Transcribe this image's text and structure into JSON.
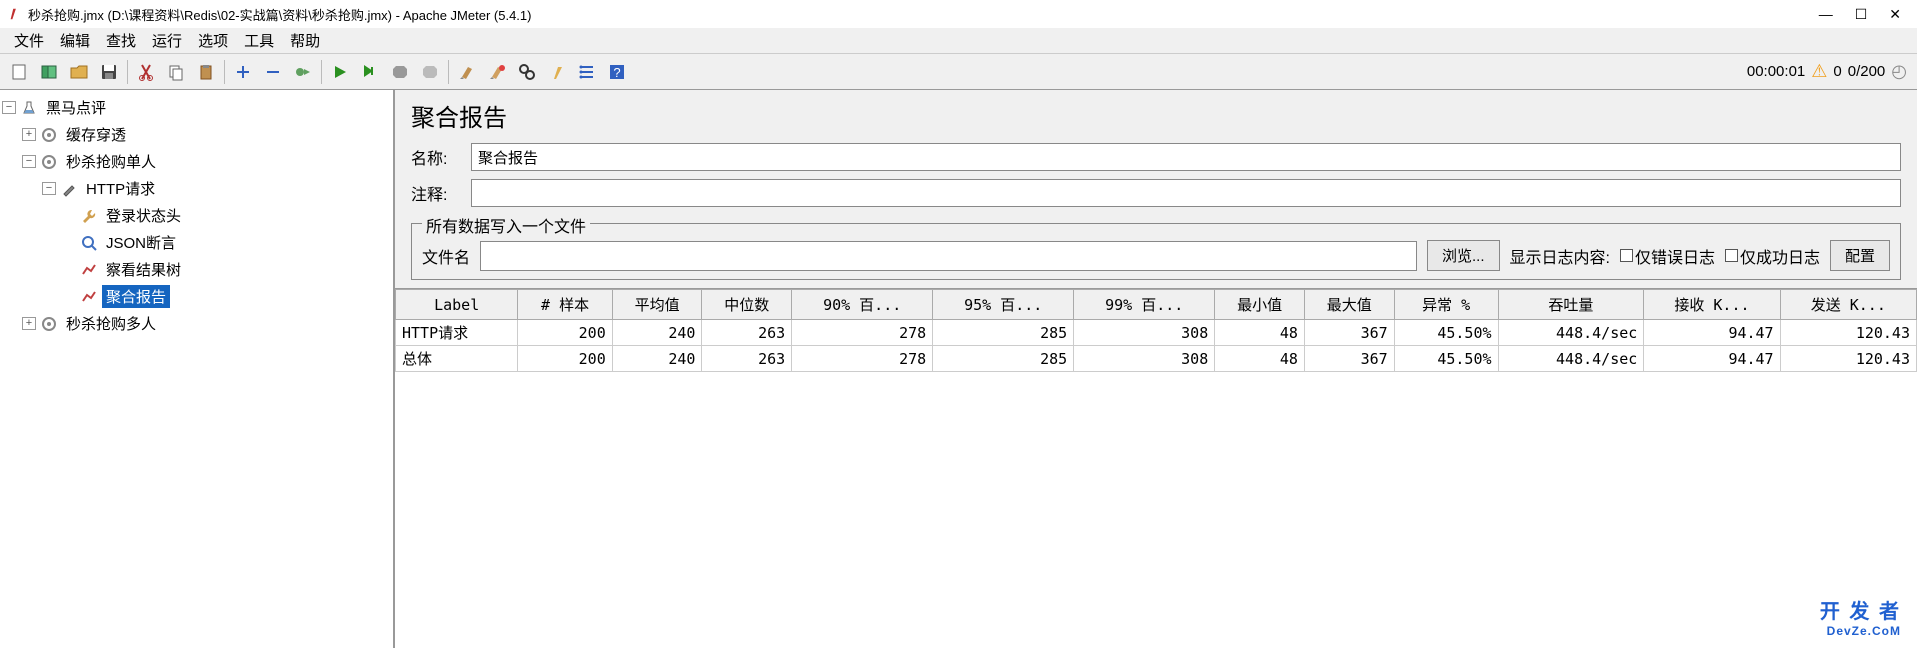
{
  "window": {
    "title": "秒杀抢购.jmx (D:\\课程资料\\Redis\\02-实战篇\\资料\\秒杀抢购.jmx) - Apache JMeter (5.4.1)"
  },
  "menu": {
    "file": "文件",
    "edit": "编辑",
    "search": "查找",
    "run": "运行",
    "options": "选项",
    "tools": "工具",
    "help": "帮助"
  },
  "toolbar_status": {
    "time": "00:00:01",
    "warn_count": "0",
    "thread_count": "0/200"
  },
  "tree": {
    "root": "黑马点评",
    "cache": "缓存穿透",
    "seckill_single": "秒杀抢购单人",
    "http_req": "HTTP请求",
    "login_header": "登录状态头",
    "json_assert": "JSON断言",
    "view_results": "察看结果树",
    "aggregate": "聚合报告",
    "seckill_multi": "秒杀抢购多人"
  },
  "panel": {
    "title": "聚合报告",
    "name_label": "名称:",
    "name_value": "聚合报告",
    "comment_label": "注释:",
    "comment_value": "",
    "file_legend": "所有数据写入一个文件",
    "filename_label": "文件名",
    "filename_value": "",
    "browse_btn": "浏览...",
    "show_log_label": "显示日志内容:",
    "only_error_label": "仅错误日志",
    "only_success_label": "仅成功日志",
    "config_btn": "配置"
  },
  "table": {
    "headers": {
      "label": "Label",
      "samples": "# 样本",
      "avg": "平均值",
      "median": "中位数",
      "p90": "90% 百...",
      "p95": "95% 百...",
      "p99": "99% 百...",
      "min": "最小值",
      "max": "最大值",
      "error": "异常 %",
      "throughput": "吞吐量",
      "recv": "接收 K...",
      "sent": "发送 K..."
    },
    "rows": [
      {
        "label": "HTTP请求",
        "samples": "200",
        "avg": "240",
        "median": "263",
        "p90": "278",
        "p95": "285",
        "p99": "308",
        "min": "48",
        "max": "367",
        "error": "45.50%",
        "throughput": "448.4/sec",
        "recv": "94.47",
        "sent": "120.43"
      },
      {
        "label": "总体",
        "samples": "200",
        "avg": "240",
        "median": "263",
        "p90": "278",
        "p95": "285",
        "p99": "308",
        "min": "48",
        "max": "367",
        "error": "45.50%",
        "throughput": "448.4/sec",
        "recv": "94.47",
        "sent": "120.43"
      }
    ]
  },
  "watermark": {
    "main": "开 发 者",
    "sub": "DevZe.CoM"
  }
}
